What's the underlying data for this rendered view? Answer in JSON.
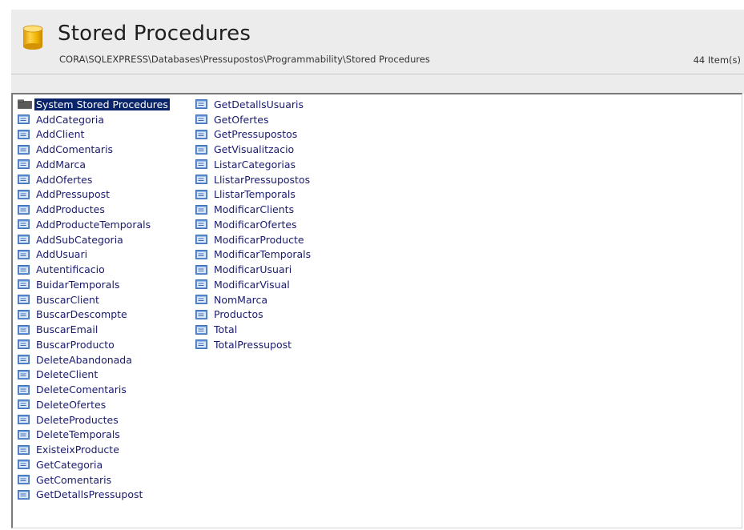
{
  "header": {
    "title": "Stored Procedures",
    "path": "CORA\\SQLEXPRESS\\Databases\\Pressupostos\\Programmability\\Stored Procedures",
    "item_count": "44 Item(s)",
    "icon": "database-cylinder-icon",
    "accent_color": "#f0b400"
  },
  "list": {
    "folder": {
      "label": "System Stored Procedures",
      "icon": "folder-icon",
      "selected": true
    },
    "item_icon": "stored-procedure-icon",
    "column1": [
      "AddCategoria",
      "AddClient",
      "AddComentaris",
      "AddMarca",
      "AddOfertes",
      "AddPressupost",
      "AddProductes",
      "AddProducteTemporals",
      "AddSubCategoria",
      "AddUsuari",
      "Autentificacio",
      "BuidarTemporals",
      "BuscarClient",
      "BuscarDescompte",
      "BuscarEmail",
      "BuscarProducto",
      "DeleteAbandonada",
      "DeleteClient",
      "DeleteComentaris",
      "DeleteOfertes",
      "DeleteProductes",
      "DeleteTemporals",
      "ExisteixProducte",
      "GetCategoria",
      "GetComentaris",
      "GetDetallsPressupost"
    ],
    "column2": [
      "GetDetallsUsuaris",
      "GetOfertes",
      "GetPressupostos",
      "GetVisualitzacio",
      "ListarCategorias",
      "LlistarPressupostos",
      "LlistarTemporals",
      "ModificarClients",
      "ModificarOfertes",
      "ModificarProducte",
      "ModificarTemporals",
      "ModificarUsuari",
      "ModificarVisual",
      "NomMarca",
      "Productos",
      "Total",
      "TotalPressupost"
    ]
  }
}
